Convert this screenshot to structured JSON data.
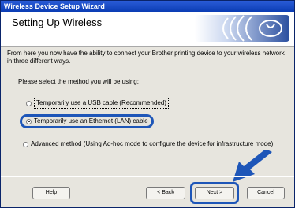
{
  "window": {
    "title": "Wireless Device Setup Wizard"
  },
  "banner": {
    "title": "Setting Up Wireless"
  },
  "main": {
    "description": "From here you now have the ability to connect your Brother printing device to your wireless network in three different ways.",
    "prompt": "Please select the method you will be using:",
    "options": [
      {
        "label": "Temporarily use a USB cable (Recommended)",
        "selected": false
      },
      {
        "label": "Temporarily use an Ethernet (LAN) cable",
        "selected": true
      },
      {
        "label": "Advanced method (Using Ad-hoc mode to configure the device for infrastructure mode)",
        "selected": false
      }
    ]
  },
  "buttons": {
    "help": "Help",
    "back": "< Back",
    "next": "Next >",
    "cancel": "Cancel"
  },
  "colors": {
    "highlight": "#1e56b8",
    "title_bar": "#0b3db4"
  },
  "icons": {
    "logo": "wireless-logo-icon",
    "arrow": "pointer-arrow-icon"
  }
}
